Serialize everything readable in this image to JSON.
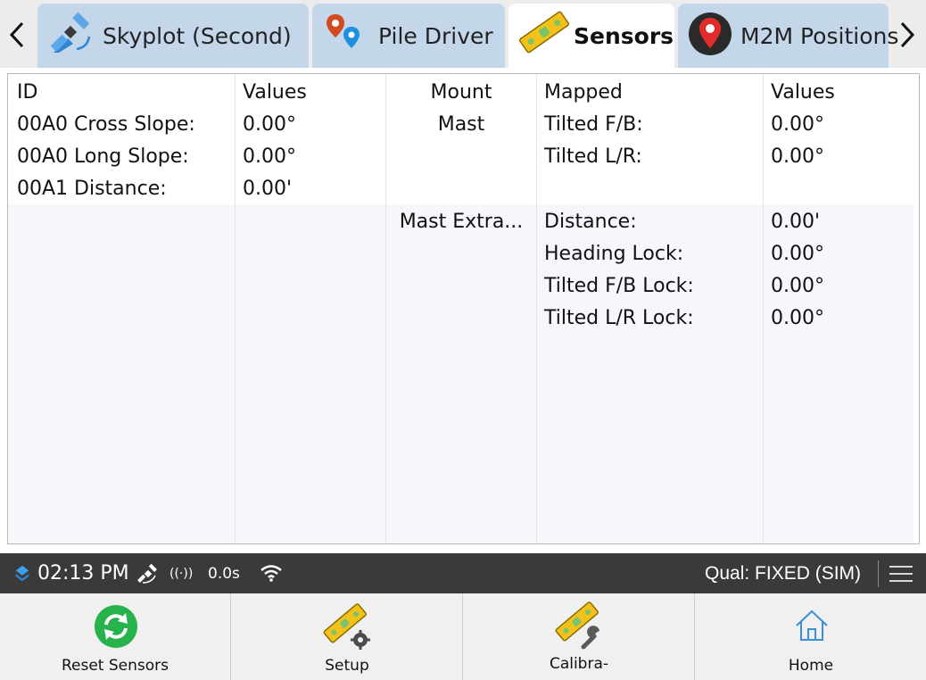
{
  "tabs": [
    {
      "label": "Skyplot (Second)",
      "icon": "satellite-icon"
    },
    {
      "label": "Pile Driver",
      "icon": "map-pins-icon"
    },
    {
      "label": "Sensors",
      "icon": "level-icon",
      "active": true
    },
    {
      "label": "M2M Positions",
      "icon": "location-pin-icon"
    }
  ],
  "table": {
    "headers": [
      "ID",
      "Values",
      "Mount",
      "Mapped",
      "Values"
    ],
    "groups": [
      {
        "ids": [
          "00A0 Cross Slope:",
          "00A0 Long Slope:",
          "00A1 Distance:"
        ],
        "values": [
          "0.00°",
          "0.00°",
          "0.00'"
        ],
        "mount": "Mast",
        "mapped": [
          "Tilted F/B:",
          "Tilted L/R:"
        ],
        "mapped_values": [
          "0.00°",
          "0.00°"
        ]
      },
      {
        "ids": [],
        "values": [],
        "mount": "Mast Extra...",
        "mapped": [
          "Distance:",
          "Heading Lock:",
          "Tilted F/B Lock:",
          "Tilted L/R Lock:"
        ],
        "mapped_values": [
          "0.00'",
          "0.00°",
          "0.00°",
          "0.00°"
        ]
      }
    ]
  },
  "status": {
    "time": "02:13 PM",
    "radio": "((·))",
    "latency": "0.0s",
    "quality": "Qual: FIXED (SIM)"
  },
  "toolbar": {
    "reset_label": "Reset Sensors",
    "setup_label": "Setup",
    "calibrate_label": "Calibra-",
    "home_label": "Home"
  },
  "colors": {
    "tab_inactive": "#c3d6ea",
    "tab_active": "#ffffff",
    "status_bar": "#3a3a3a",
    "reset_green": "#28b24b",
    "level_yellow": "#f2c21a",
    "home_blue": "#3a8fd6"
  }
}
